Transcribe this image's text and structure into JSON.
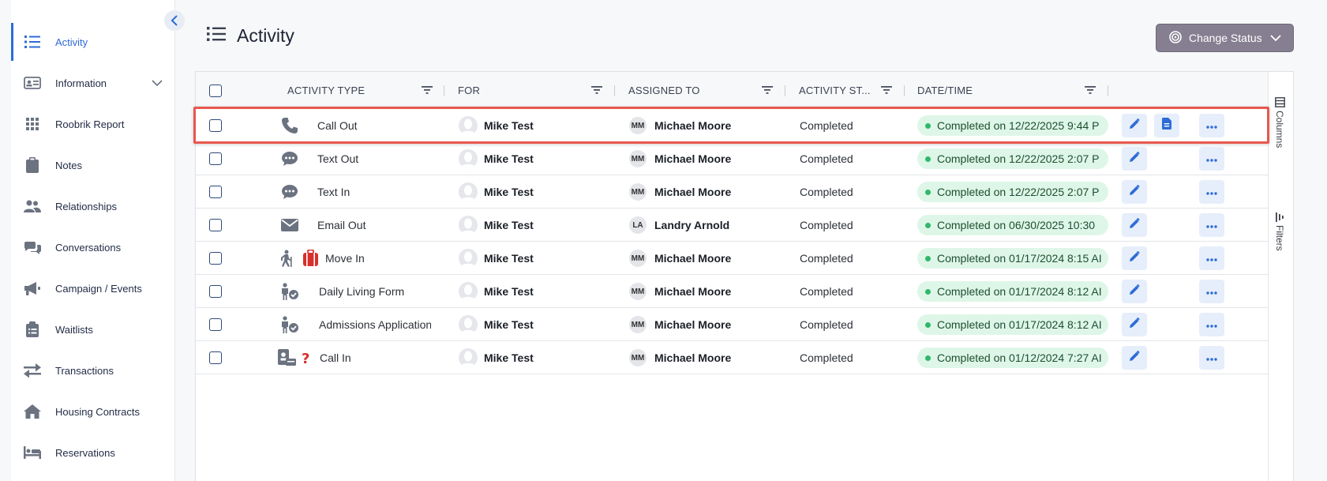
{
  "sidebar": {
    "items": [
      {
        "label": "Activity",
        "icon": "list-icon"
      },
      {
        "label": "Information",
        "icon": "id-card-icon"
      },
      {
        "label": "Roobrik Report",
        "icon": "grid-icon"
      },
      {
        "label": "Notes",
        "icon": "clipboard-icon"
      },
      {
        "label": "Relationships",
        "icon": "users-icon"
      },
      {
        "label": "Conversations",
        "icon": "chat-icon"
      },
      {
        "label": "Campaign / Events",
        "icon": "megaphone-icon"
      },
      {
        "label": "Waitlists",
        "icon": "clipboard-list-icon"
      },
      {
        "label": "Transactions",
        "icon": "exchange-icon"
      },
      {
        "label": "Housing Contracts",
        "icon": "home-icon"
      },
      {
        "label": "Reservations",
        "icon": "bed-icon"
      }
    ]
  },
  "header": {
    "title": "Activity",
    "change_status_label": "Change Status"
  },
  "grid": {
    "columns": [
      "ACTIVITY TYPE",
      "FOR",
      "ASSIGNED TO",
      "ACTIVITY ST...",
      "DATE/TIME"
    ],
    "side_tools": {
      "columns": "Columns",
      "filters": "Filters"
    },
    "rows": [
      {
        "type": "Call Out",
        "icon": "phone-icon",
        "for": "Mike Test",
        "initials": "MM",
        "assigned": "Michael Moore",
        "status": "Completed",
        "date": "Completed on 12/22/2025 9:44 P",
        "has_doc": true
      },
      {
        "type": "Text Out",
        "icon": "chat-bubble-icon",
        "for": "Mike Test",
        "initials": "MM",
        "assigned": "Michael Moore",
        "status": "Completed",
        "date": "Completed on 12/22/2025 2:07 P",
        "has_doc": false
      },
      {
        "type": "Text In",
        "icon": "chat-bubble-icon",
        "for": "Mike Test",
        "initials": "MM",
        "assigned": "Michael Moore",
        "status": "Completed",
        "date": "Completed on 12/22/2025 2:07 P",
        "has_doc": false
      },
      {
        "type": "Email Out",
        "icon": "envelope-icon",
        "for": "Mike Test",
        "initials": "LA",
        "assigned": "Landry Arnold",
        "status": "Completed",
        "date": "Completed on 06/30/2025 10:30",
        "has_doc": false
      },
      {
        "type": "Move In",
        "icon": "walking-luggage-icon",
        "for": "Mike Test",
        "initials": "MM",
        "assigned": "Michael Moore",
        "status": "Completed",
        "date": "Completed on 01/17/2024 8:15 AI",
        "has_doc": false
      },
      {
        "type": "Daily Living Form",
        "icon": "person-check-icon",
        "for": "Mike Test",
        "initials": "MM",
        "assigned": "Michael Moore",
        "status": "Completed",
        "date": "Completed on 01/17/2024 8:12 AI",
        "has_doc": false
      },
      {
        "type": "Admissions Application",
        "icon": "person-check-icon",
        "for": "Mike Test",
        "initials": "MM",
        "assigned": "Michael Moore",
        "status": "Completed",
        "date": "Completed on 01/17/2024 8:12 AI",
        "has_doc": false
      },
      {
        "type": "Call In",
        "icon": "contact-question-icon",
        "for": "Mike Test",
        "initials": "MM",
        "assigned": "Michael Moore",
        "status": "Completed",
        "date": "Completed on 01/12/2024 7:27 AI",
        "has_doc": false
      }
    ]
  },
  "colors": {
    "accent": "#2e6bd6",
    "status_pill_bg": "#def6e7",
    "status_dot": "#2fb86a",
    "highlight_border": "#e8584e",
    "change_status_bg": "#857f91"
  }
}
